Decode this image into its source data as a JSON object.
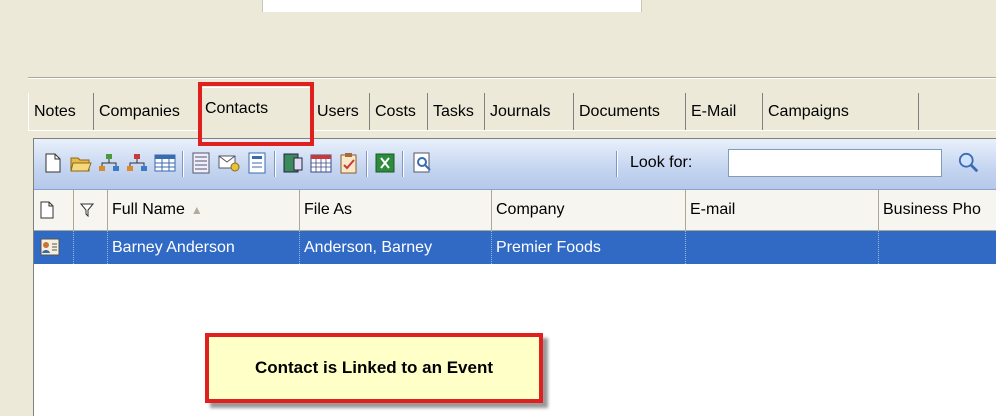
{
  "tabs": [
    "Notes",
    "Companies",
    "Contacts",
    "Users",
    "Costs",
    "Tasks",
    "Journals",
    "Documents",
    "E-Mail",
    "Campaigns"
  ],
  "active_tab": "Contacts",
  "toolbar": {
    "look_for_label": "Look for:",
    "look_for_value": "",
    "icons": [
      "new-document-icon",
      "open-folder-icon",
      "link-contact-icon",
      "unlink-contact-icon",
      "table-view-icon",
      "list-view-icon",
      "email-icon",
      "form-icon",
      "report-icon",
      "calendar-icon",
      "checklist-icon",
      "excel-export-icon",
      "search-tool-icon",
      "find-icon"
    ]
  },
  "grid": {
    "columns": [
      "Full Name",
      "File As",
      "Company",
      "E-mail",
      "Business Pho"
    ],
    "rows": [
      {
        "full_name": "Barney Anderson",
        "file_as": "Anderson, Barney",
        "company": "Premier Foods",
        "email": "",
        "business_phone": ""
      }
    ]
  },
  "callout": {
    "text": "Contact is Linked to an Event"
  },
  "colors": {
    "selection": "#316ac5",
    "highlight_border": "#e0201e",
    "callout_bg": "#ffffc8"
  }
}
